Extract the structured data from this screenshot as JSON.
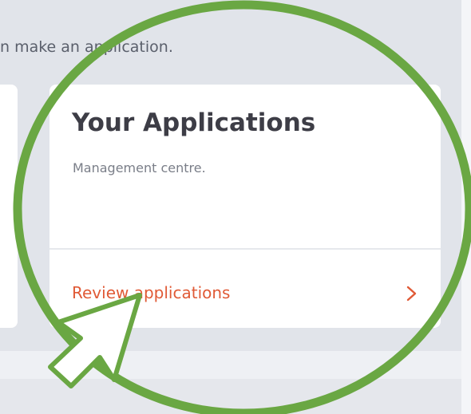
{
  "intro": {
    "text": "n make an application."
  },
  "applications_card": {
    "title": "Your Applications",
    "description": "Management centre.",
    "action_label": "Review applications",
    "action_icon": "chevron-right-icon"
  },
  "annotations": {
    "ring_icon": "highlight-circle",
    "pointer_icon": "pointer-arrow-icon"
  },
  "colors": {
    "page_bg": "#e1e4ea",
    "card_bg": "#ffffff",
    "accent": "#e05a36",
    "title_text": "#3d3d46",
    "ring": "#6aa743"
  }
}
